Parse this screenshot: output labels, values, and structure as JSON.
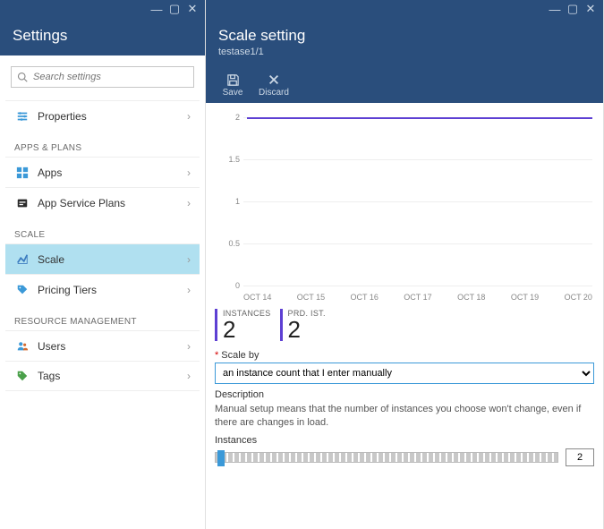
{
  "left": {
    "title": "Settings",
    "search_placeholder": "Search settings",
    "sections": {
      "top": [
        {
          "icon": "sliders",
          "label": "Properties"
        }
      ],
      "apps_plans_label": "APPS & PLANS",
      "apps_plans": [
        {
          "icon": "grid",
          "label": "Apps"
        },
        {
          "icon": "plan",
          "label": "App Service Plans"
        }
      ],
      "scale_label": "SCALE",
      "scale": [
        {
          "icon": "scale",
          "label": "Scale",
          "active": true
        },
        {
          "icon": "tag",
          "label": "Pricing Tiers"
        }
      ],
      "rm_label": "RESOURCE MANAGEMENT",
      "rm": [
        {
          "icon": "users",
          "label": "Users"
        },
        {
          "icon": "tags",
          "label": "Tags"
        }
      ]
    }
  },
  "right": {
    "title": "Scale setting",
    "subtitle": "testase1/1",
    "commands": {
      "save": "Save",
      "discard": "Discard"
    },
    "metrics": {
      "instances_label": "INSTANCES",
      "instances_value": "2",
      "prdist_label": "PRD. IST.",
      "prdist_value": "2"
    },
    "scale_by_label": "Scale by",
    "scale_by_value": "an instance count that I enter manually",
    "description_label": "Description",
    "description_text": "Manual setup means that the number of instances you choose won't change, even if there are changes in load.",
    "instances_label": "Instances",
    "instances_value": "2"
  },
  "chart_data": {
    "type": "line",
    "series": [
      {
        "name": "Instances",
        "values": [
          2,
          2,
          2,
          2,
          2,
          2,
          2
        ]
      }
    ],
    "categories": [
      "OCT 14",
      "OCT 15",
      "OCT 16",
      "OCT 17",
      "OCT 18",
      "OCT 19",
      "OCT 20"
    ],
    "y_ticks": [
      0,
      0.5,
      1,
      1.5,
      2
    ],
    "ylim": [
      0,
      2
    ],
    "xlabel": "",
    "ylabel": ""
  }
}
